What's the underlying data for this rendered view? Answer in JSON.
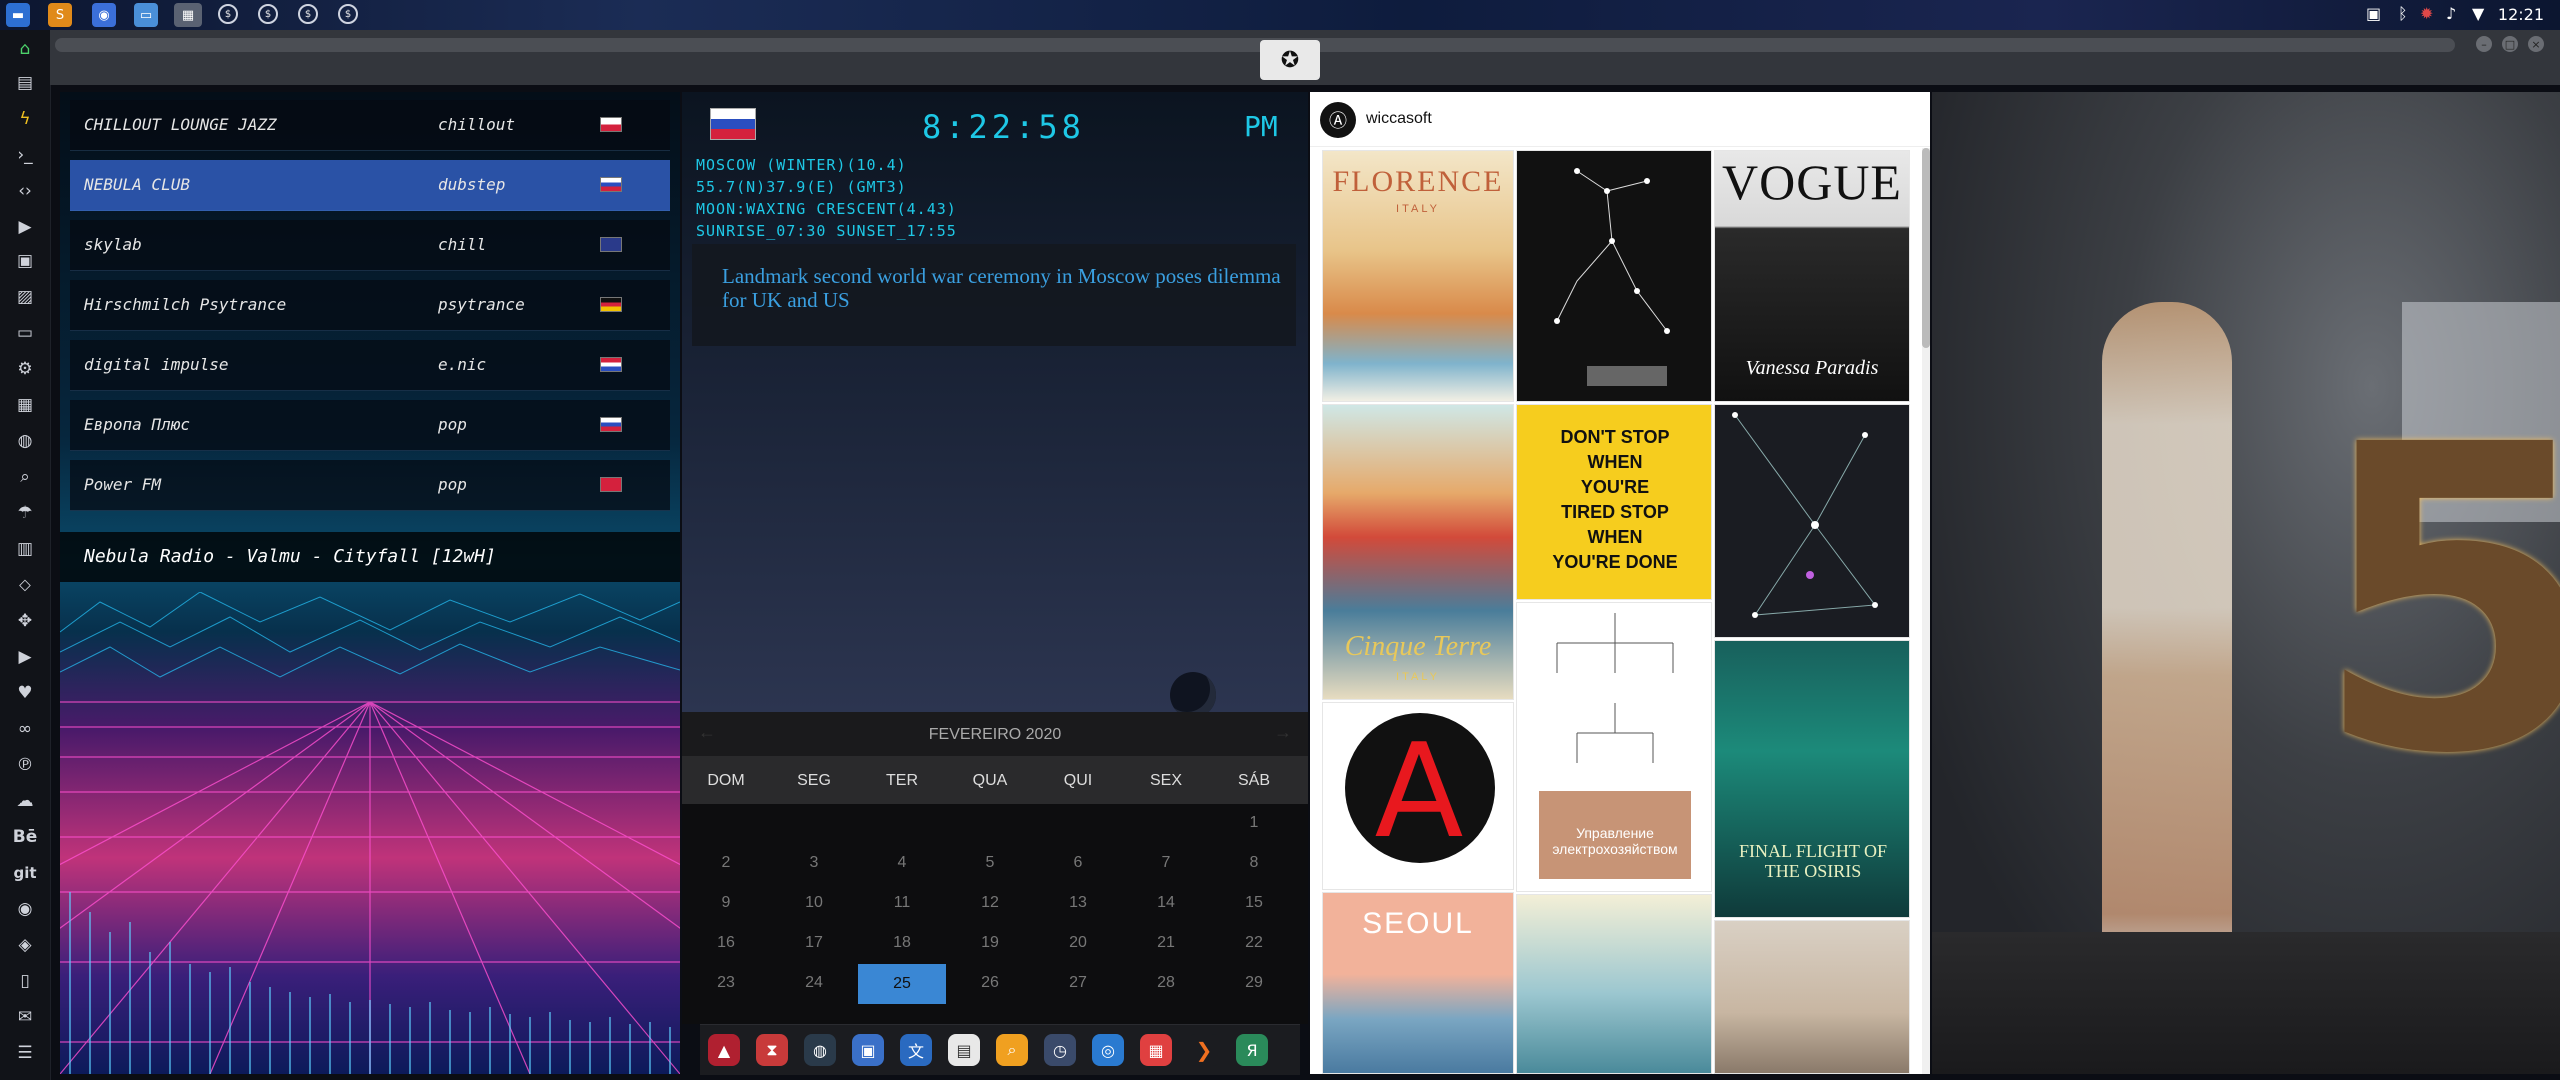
{
  "topbar": {
    "workspaces": [
      "$",
      "$",
      "$",
      "$"
    ],
    "clock": "12:21"
  },
  "window": {
    "emblem_icon": "rebel-alliance-icon"
  },
  "radio": {
    "stations": [
      {
        "name": "CHILLOUT LOUNGE JAZZ",
        "genre": "chillout",
        "flag": "poland"
      },
      {
        "name": "NEBULA CLUB",
        "genre": "dubstep",
        "flag": "russia"
      },
      {
        "name": "skylab",
        "genre": "chill",
        "flag": "uk"
      },
      {
        "name": "Hirschmilch Psytrance",
        "genre": "psytrance",
        "flag": "germany"
      },
      {
        "name": "digital impulse",
        "genre": "e.nic",
        "flag": "croatia"
      },
      {
        "name": "Европа Плюс",
        "genre": "pop",
        "flag": "russia"
      },
      {
        "name": "Power FM",
        "genre": "pop",
        "flag": "turkey"
      }
    ],
    "now_playing": "Nebula Radio - Valmu - Cityfall [12wH]"
  },
  "clock_widget": {
    "time": "8:22:58",
    "ampm": "PM",
    "lines": [
      "MOSCOW (WINTER)(10.4)",
      "55.7(N)37.9(E) (GMT3)",
      "MOON:WAXING CRESCENT(4.43)",
      "SUNRISE_07:30 SUNSET_17:55"
    ],
    "news": "Landmark second world war ceremony in Moscow poses dilemma for UK and US"
  },
  "calendar": {
    "title": "FEVEREIRO 2020",
    "weekdays": [
      "DOM",
      "SEG",
      "TER",
      "QUA",
      "QUI",
      "SEX",
      "SÁB"
    ],
    "rows": [
      [
        "",
        "",
        "",
        "",
        "",
        "",
        "1"
      ],
      [
        "2",
        "3",
        "4",
        "5",
        "6",
        "7",
        "8"
      ],
      [
        "9",
        "10",
        "11",
        "12",
        "13",
        "14",
        "15"
      ],
      [
        "16",
        "17",
        "18",
        "19",
        "20",
        "21",
        "22"
      ],
      [
        "23",
        "24",
        "25",
        "26",
        "27",
        "28",
        "29"
      ]
    ],
    "today": "25"
  },
  "pinterest": {
    "username": "wiccasoft",
    "pins": [
      {
        "title": "FLORENCE",
        "subtitle": "ITALY"
      },
      {
        "title": "",
        "subtitle": ""
      },
      {
        "title": "VOGUE",
        "subtitle": "Vanessa Paradis"
      },
      {
        "title": "Cinque Terre",
        "subtitle": "ITALY"
      },
      {
        "title": "DON'T STOP WHEN YOU'RE TIRED STOP WHEN YOU'RE DONE",
        "subtitle": ""
      },
      {
        "title": "",
        "subtitle": ""
      },
      {
        "title": "Управление электрохозяйством",
        "subtitle": ""
      },
      {
        "title": "FINAL FLIGHT OF THE OSIRIS",
        "subtitle": ""
      },
      {
        "title": "SEOUL",
        "subtitle": ""
      }
    ]
  },
  "colors": {
    "accent_cyan": "#1ec8e6",
    "active_station": "#2a52a6",
    "today_highlight": "#3a87d4",
    "news_link": "#3a9fe0"
  }
}
